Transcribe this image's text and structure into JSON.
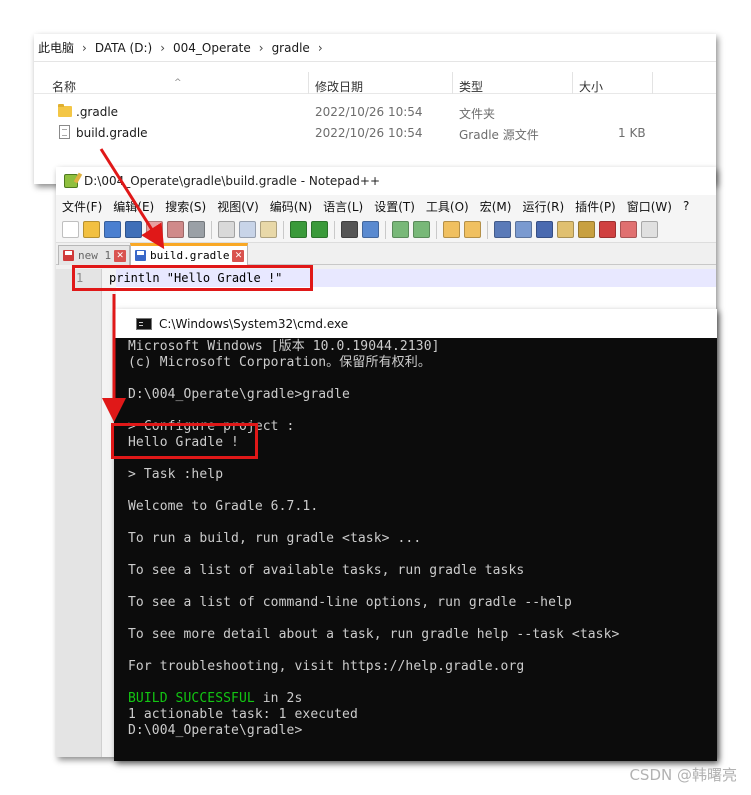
{
  "explorer": {
    "breadcrumb": [
      "此电脑",
      "DATA (D:)",
      "004_Operate",
      "gradle"
    ],
    "columns": {
      "name": "名称",
      "modified": "修改日期",
      "type": "类型",
      "size": "大小"
    },
    "files": [
      {
        "name": ".gradle",
        "modified": "2022/10/26 10:54",
        "type": "文件夹",
        "size": "",
        "icon": "folder-icon"
      },
      {
        "name": "build.gradle",
        "modified": "2022/10/26 10:54",
        "type": "Gradle 源文件",
        "size": "1 KB",
        "icon": "file-icon"
      }
    ]
  },
  "notepad": {
    "title": "D:\\004_Operate\\gradle\\build.gradle - Notepad++",
    "menu": [
      "文件(F)",
      "编辑(E)",
      "搜索(S)",
      "视图(V)",
      "编码(N)",
      "语言(L)",
      "设置(T)",
      "工具(O)",
      "宏(M)",
      "运行(R)",
      "插件(P)",
      "窗口(W)",
      "?"
    ],
    "tabs": [
      {
        "label": "new 1",
        "active": false
      },
      {
        "label": "build.gradle",
        "active": true
      }
    ],
    "tab_close_glyph": "✕",
    "line_number": "1",
    "code_line": "println \"Hello Gradle !\""
  },
  "cmd": {
    "title": "C:\\Windows\\System32\\cmd.exe",
    "lines": [
      "Microsoft Windows [版本 10.0.19044.2130]",
      "(c) Microsoft Corporation。保留所有权利。",
      "",
      "D:\\004_Operate\\gradle>gradle",
      "",
      "> Configure project :",
      "Hello Gradle !",
      "",
      "> Task :help",
      "",
      "Welcome to Gradle 6.7.1.",
      "",
      "To run a build, run gradle <task> ...",
      "",
      "To see a list of available tasks, run gradle tasks",
      "",
      "To see a list of command-line options, run gradle --help",
      "",
      "To see more detail about a task, run gradle help --task <task>",
      "",
      "For troubleshooting, visit https://help.gradle.org",
      "",
      "BUILD SUCCESSFUL in 2s",
      "1 actionable task: 1 executed",
      "D:\\004_Operate\\gradle>"
    ],
    "build_success": "BUILD SUCCESSFUL",
    "build_time": " in 2s"
  },
  "watermark": "CSDN @韩曙亮",
  "colors": {
    "annotation_red": "#e01818",
    "build_success_green": "#13c613",
    "tab_active_accent": "#f9a825"
  }
}
